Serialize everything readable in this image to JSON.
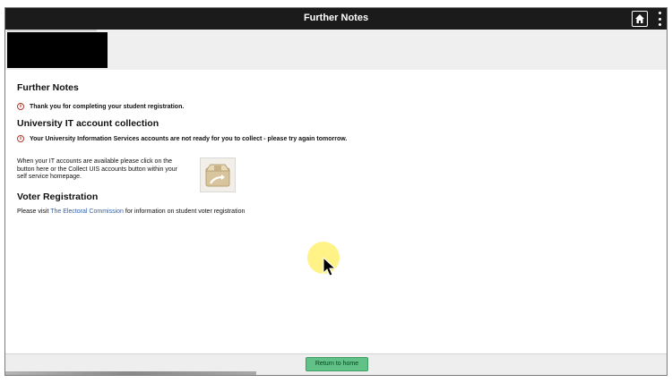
{
  "window": {
    "title": "Further Notes"
  },
  "topbar": {
    "home_icon": "home-icon",
    "menu_icon": "kebab-menu-icon"
  },
  "sections": {
    "further_notes": {
      "heading": "Further Notes",
      "message": "Thank you for completing your student registration.",
      "icon": "info-icon"
    },
    "it_account": {
      "heading": "University IT account collection",
      "message": "Your University Information Services accounts are not ready for you to collect - please try again tomorrow.",
      "icon": "info-icon",
      "instruction": "When your IT accounts are available please click on the button here or the Collect UIS accounts button within your self service homepage.",
      "button_icon": "box-collect-icon"
    },
    "voter": {
      "heading": "Voter Registration",
      "text_before": "Please visit",
      "link_text": "The Electoral Commission",
      "text_after": "for information on student voter registration"
    }
  },
  "footer": {
    "return_label": "Return to home"
  },
  "colors": {
    "topbar": "#1b1b1b",
    "banner": "#efefef",
    "link": "#2f5fa8",
    "return_button": "#62c186",
    "info_icon": "#b33a2b"
  }
}
